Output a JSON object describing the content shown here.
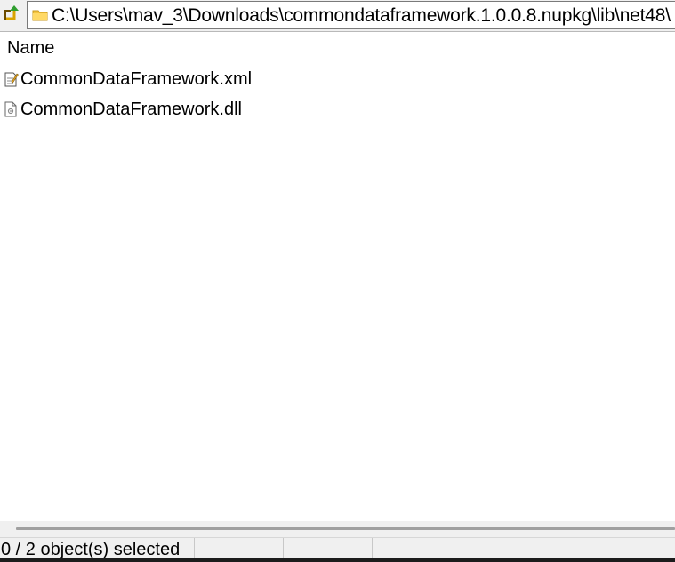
{
  "toolbar": {
    "up_icon": "folder-up-icon",
    "address": {
      "folder_icon": "folder-icon",
      "path": "C:\\Users\\mav_3\\Downloads\\commondataframework.1.0.0.8.nupkg\\lib\\net48\\"
    }
  },
  "list": {
    "columns": [
      "Name"
    ],
    "files": [
      {
        "name": "CommonDataFramework.xml",
        "icon": "xml-file-icon"
      },
      {
        "name": "CommonDataFramework.dll",
        "icon": "dll-file-icon"
      }
    ]
  },
  "status": {
    "selection": "0 / 2 object(s) selected"
  },
  "colors": {
    "toolbar_bg": "#f0f0f0",
    "folder_yellow": "#f5c542",
    "up_arrow_green": "#2f9e2f"
  }
}
